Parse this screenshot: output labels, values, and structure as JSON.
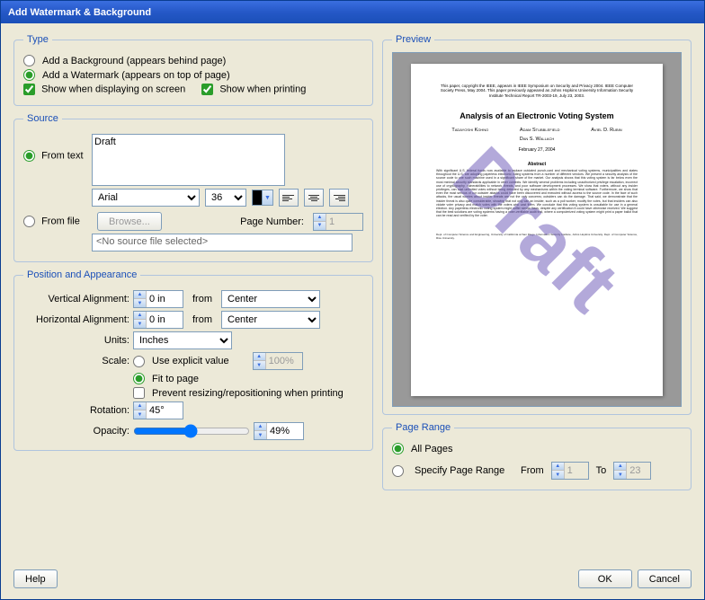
{
  "window": {
    "title": "Add Watermark & Background"
  },
  "type": {
    "legend": "Type",
    "background_label": "Add a Background (appears behind page)",
    "watermark_label": "Add a Watermark (appears on top of page)",
    "show_screen_label": "Show when displaying on screen",
    "show_print_label": "Show when printing",
    "selected": "watermark",
    "show_screen": true,
    "show_print": true
  },
  "source": {
    "legend": "Source",
    "from_text_label": "From text",
    "from_file_label": "From file",
    "selected": "text",
    "text_value": "Draft",
    "font": "Arial",
    "font_size": "36",
    "browse_label": "Browse...",
    "page_number_label": "Page Number:",
    "page_number_value": "1",
    "no_file_label": "<No source file selected>"
  },
  "position": {
    "legend": "Position and Appearance",
    "valign_label": "Vertical Alignment:",
    "valign_value": "0 in",
    "halign_label": "Horizontal Alignment:",
    "halign_value": "0 in",
    "from_label": "from",
    "valign_from": "Center",
    "halign_from": "Center",
    "units_label": "Units:",
    "units_value": "Inches",
    "scale_label": "Scale:",
    "scale_explicit_label": "Use explicit value",
    "scale_value": "100%",
    "scale_fit_label": "Fit to page",
    "scale_selected": "fit",
    "prevent_resize_label": "Prevent resizing/repositioning when printing",
    "prevent_resize": false,
    "rotation_label": "Rotation:",
    "rotation_value": "45°",
    "opacity_label": "Opacity:",
    "opacity_value": "49%"
  },
  "preview": {
    "legend": "Preview",
    "watermark_text": "Draft",
    "doc_title": "Analysis of an Electronic Voting System",
    "authors": [
      "Tadayoshi Kohno",
      "Adam Stubblefield",
      "Aviel D. Rubin",
      "Dan S. Wallach"
    ],
    "date": "February 27, 2004",
    "abstract_heading": "Abstract",
    "header_note": "This paper, copyright the IEEE, appears in IEEE Symposium on Security and Privacy 2004. IEEE Computer Society Press, May 2004. This paper previously appeared as Johns Hopkins University Information Security Institute Technical Report TR-2003-19, July 23, 2003."
  },
  "page_range": {
    "legend": "Page Range",
    "all_label": "All Pages",
    "specify_label": "Specify Page Range",
    "selected": "all",
    "from_label": "From",
    "from_value": "1",
    "to_label": "To",
    "to_value": "23"
  },
  "buttons": {
    "help": "Help",
    "ok": "OK",
    "cancel": "Cancel"
  }
}
